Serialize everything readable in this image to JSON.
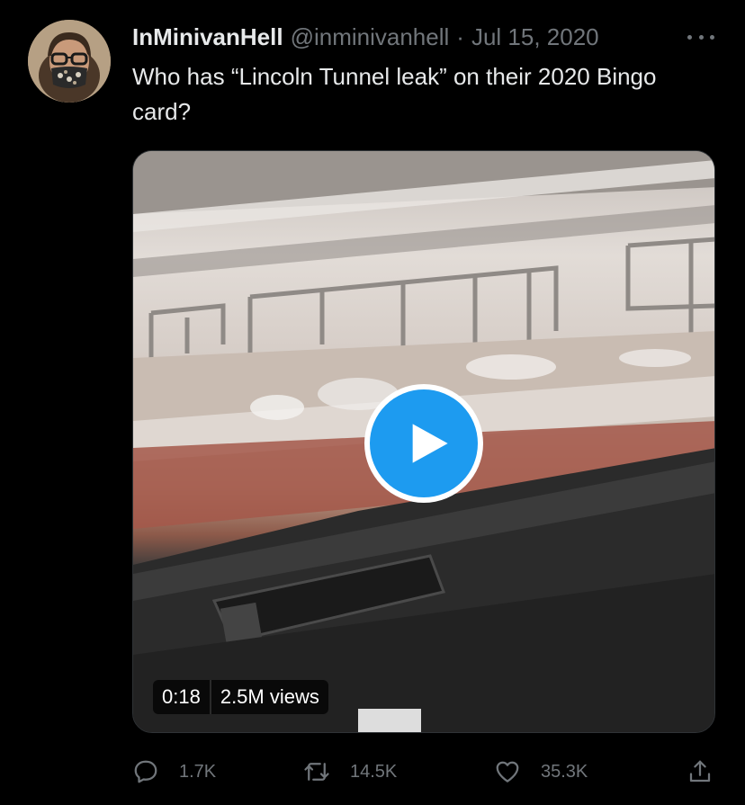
{
  "tweet": {
    "display_name": "InMinivanHell",
    "handle": "@inminivanhell",
    "separator": "·",
    "date": "Jul 15, 2020",
    "text": "Who has “Lincoln Tunnel leak” on their 2020 Bingo card?",
    "avatar_icon": "profile-photo",
    "more_icon": "more-horizontal-icon"
  },
  "media": {
    "type": "video",
    "duration": "0:18",
    "views": "2.5M views",
    "play_icon": "play-icon"
  },
  "actions": {
    "reply": {
      "icon": "reply-icon",
      "count": "1.7K"
    },
    "retweet": {
      "icon": "retweet-icon",
      "count": "14.5K"
    },
    "like": {
      "icon": "heart-icon",
      "count": "35.3K"
    },
    "share": {
      "icon": "share-icon"
    }
  },
  "colors": {
    "background": "#000000",
    "accent": "#1d9bf0",
    "muted_text": "#71767b",
    "primary_text": "#e7e9ea"
  }
}
